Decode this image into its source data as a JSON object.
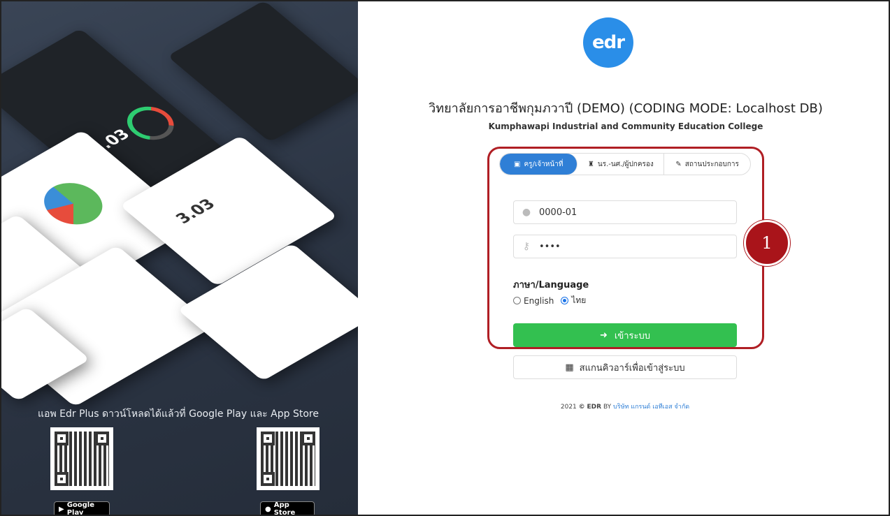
{
  "promo": {
    "caption": "แอพ Edr Plus ดาวน์โหลดได้แล้วที่ Google Play และ App Store",
    "google_play_label": "Google Play",
    "app_store_label": "App Store",
    "screenshot_stats": [
      "3.03",
      "3.03"
    ]
  },
  "brand": {
    "logo_text": "edr",
    "accent": "#2a8ee8"
  },
  "org": {
    "title": "วิทยาลัยการอาชีพกุมภวาปี (DEMO) (CODING MODE: Localhost DB)",
    "subtitle": "Kumphawapi Industrial and Community Education College"
  },
  "tabs": [
    {
      "label": "ครู/เจ้าหน้าที่",
      "icon": "teacher-icon",
      "active": true
    },
    {
      "label": "นร.-นศ./ผู้ปกครอง",
      "icon": "student-icon",
      "active": false
    },
    {
      "label": "สถานประกอบการ",
      "icon": "wrench-icon",
      "active": false
    }
  ],
  "form": {
    "username": "0000-01",
    "password": "••••",
    "language_label": "ภาษา/Language",
    "lang_english": "English",
    "lang_thai": "ไทย",
    "selected_language": "ไทย",
    "login_label": "เข้าระบบ",
    "qr_login_label": "สแกนคิวอาร์เพื่อเข้าสู่ระบบ"
  },
  "annotation": {
    "marker_number": "1",
    "color": "#a9141a"
  },
  "footer": {
    "year": "2021",
    "copyright_symbol": "©",
    "brand": "EDR",
    "by": "BY",
    "company": "บริษัท แกรนด์ เอทีเอส จำกัด"
  }
}
